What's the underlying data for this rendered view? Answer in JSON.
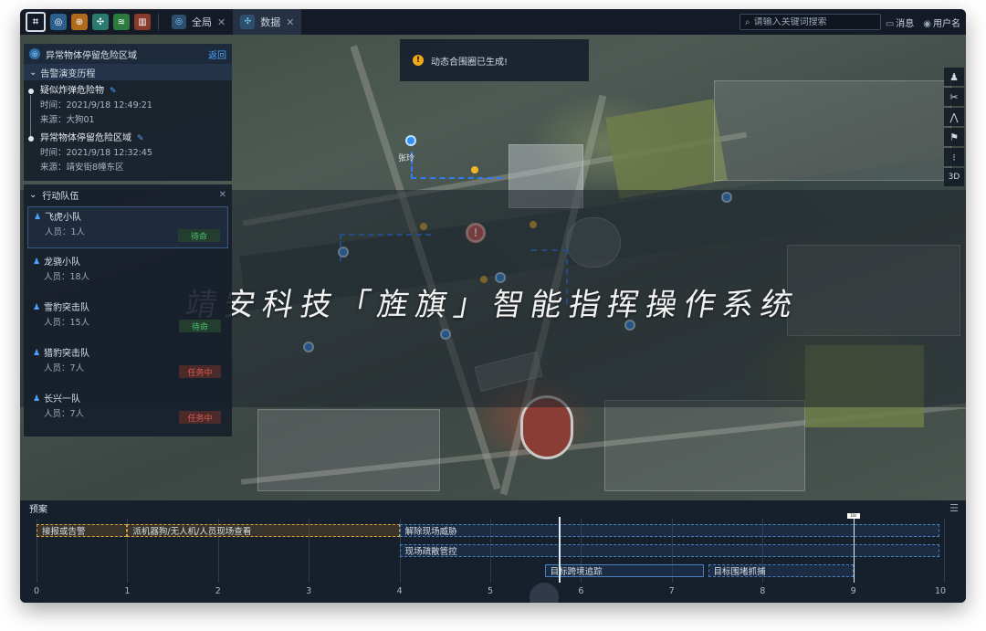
{
  "topbar": {
    "tools": [
      {
        "name": "globe-tool-icon",
        "color": "#2d5f8d",
        "glyph": "◎"
      },
      {
        "name": "target-tool-icon",
        "color": "#b06a1e",
        "glyph": "⊕"
      },
      {
        "name": "network-tool-icon",
        "color": "#2b7a6e",
        "glyph": "✣"
      },
      {
        "name": "layers-tool-icon",
        "color": "#2d7a3e",
        "glyph": "≋"
      },
      {
        "name": "buildings-tool-icon",
        "color": "#8a3a2a",
        "glyph": "▥"
      }
    ],
    "tabs": [
      {
        "label": "全局",
        "icon": "globe-icon",
        "active": false
      },
      {
        "label": "数据",
        "icon": "network-icon",
        "active": true
      }
    ],
    "search_placeholder": "请输入关键词搜索",
    "messages_label": "消息",
    "user_label": "用户名"
  },
  "toast": {
    "text": "动态合围圈已生成!"
  },
  "banner": {
    "title": "靖安科技「旌旗」智能指挥操作系统"
  },
  "right_tools": [
    {
      "name": "person-icon",
      "glyph": "♟"
    },
    {
      "name": "scissors-icon",
      "glyph": "✂"
    },
    {
      "name": "hills-icon",
      "glyph": "⋀"
    },
    {
      "name": "flag-icon",
      "glyph": "⚑"
    },
    {
      "name": "traffic-light-icon",
      "glyph": "⁝"
    },
    {
      "name": "3d-toggle",
      "glyph": "3D"
    }
  ],
  "panel": {
    "title": "异常物体停留危险区域",
    "back_label": "返回",
    "history_title": "告警演变历程",
    "history": [
      {
        "title": "疑似炸弹危险物",
        "time": "时间：2021/9/18 12:49:21",
        "source": "来源：大狗01"
      },
      {
        "title": "异常物体停留危险区域",
        "time": "时间：2021/9/18 12:32:45",
        "source": "来源：靖安街8幢东区"
      }
    ],
    "teams_title": "行动队伍",
    "teams": [
      {
        "name": "飞虎小队",
        "count": "人员：1人",
        "status": "待命",
        "status_type": "standby",
        "selected": true
      },
      {
        "name": "龙骁小队",
        "count": "人员：18人",
        "status": "",
        "status_type": "",
        "selected": false
      },
      {
        "name": "雪豹突击队",
        "count": "人员：15人",
        "status": "待命",
        "status_type": "standby",
        "selected": false
      },
      {
        "name": "猎豹突击队",
        "count": "人员：7人",
        "status": "任务中",
        "status_type": "busy",
        "selected": false
      },
      {
        "name": "长兴一队",
        "count": "人员：7人",
        "status": "任务中",
        "status_type": "busy",
        "selected": false
      }
    ]
  },
  "map_labels": {
    "pin_label": "张玲"
  },
  "plan": {
    "title": "预案",
    "ticks": [
      "0",
      "1",
      "2",
      "3",
      "4",
      "5",
      "6",
      "7",
      "8",
      "9",
      "10"
    ],
    "bars": [
      {
        "label": "接报或告警",
        "start": 0,
        "end": 1,
        "row": 0,
        "style": "orange"
      },
      {
        "label": "派机器狗/无人机/人员现场查看",
        "start": 1,
        "end": 4,
        "row": 0,
        "style": "orange"
      },
      {
        "label": "解除现场威胁",
        "start": 4,
        "end": 10,
        "row": 0,
        "style": "blue"
      },
      {
        "label": "现场疏散管控",
        "start": 4,
        "end": 10,
        "row": 1,
        "style": "blue"
      },
      {
        "label": "目标跨境追踪",
        "start": 5.6,
        "end": 7.35,
        "row": 2,
        "style": "blue-solid"
      },
      {
        "label": "目标围堵抓捕",
        "start": 7.4,
        "end": 9,
        "row": 2,
        "style": "blue"
      }
    ],
    "cursor_value": 5.75,
    "end_marker_value": 9,
    "end_marker_label": "10s"
  }
}
